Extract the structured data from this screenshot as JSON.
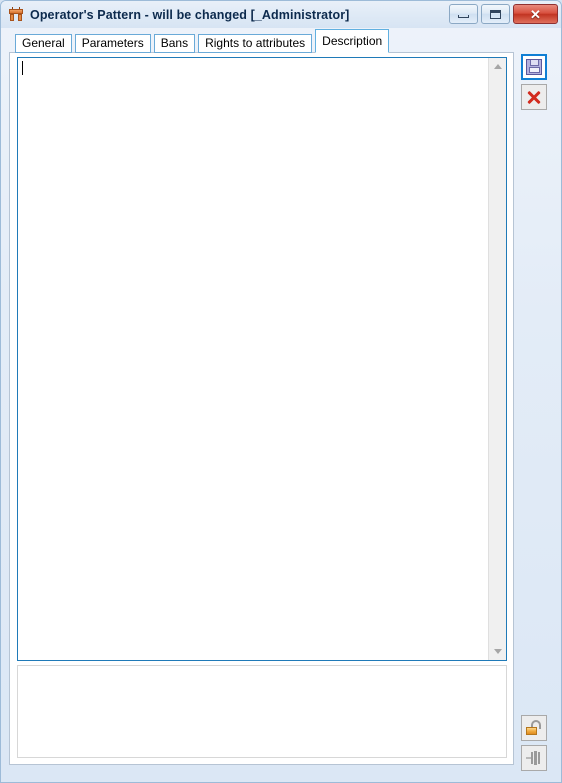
{
  "window": {
    "title": "Operator's Pattern - will be changed [_Administrator]",
    "app_icon": "operator-pattern-icon",
    "controls": {
      "minimize_label": "–",
      "maximize_label": "□",
      "close_label": "✕"
    }
  },
  "tabs": [
    {
      "label": "General",
      "name": "tab-general",
      "active": false
    },
    {
      "label": "Parameters",
      "name": "tab-parameters",
      "active": false
    },
    {
      "label": "Bans",
      "name": "tab-bans",
      "active": false
    },
    {
      "label": "Rights to attributes",
      "name": "tab-rights-to-attributes",
      "active": false
    },
    {
      "label": "Description",
      "name": "tab-description",
      "active": true
    }
  ],
  "description": {
    "value": "",
    "placeholder": "",
    "caret_visible": true,
    "scrollbar": {
      "up_arrow": "scroll-up-arrow",
      "down_arrow": "scroll-down-arrow"
    }
  },
  "toolbar": {
    "save": {
      "label": "Save",
      "icon": "floppy-disk-icon",
      "selected": true,
      "enabled": true
    },
    "cancel": {
      "label": "Cancel",
      "icon": "red-x-icon",
      "selected": false,
      "enabled": true
    },
    "unlock": {
      "label": "Unlock",
      "icon": "open-padlock-icon",
      "selected": false,
      "enabled": true
    },
    "pin": {
      "label": "Pin",
      "icon": "pin-icon",
      "selected": false,
      "enabled": false
    }
  },
  "colors": {
    "title_text": "#0c2a4d",
    "accent_blue": "#1f7ab8",
    "tab_border": "#6aaad8",
    "close_red": "#c13422",
    "lock_orange": "#f0a93c",
    "save_highlight": "#0f7fd4"
  }
}
